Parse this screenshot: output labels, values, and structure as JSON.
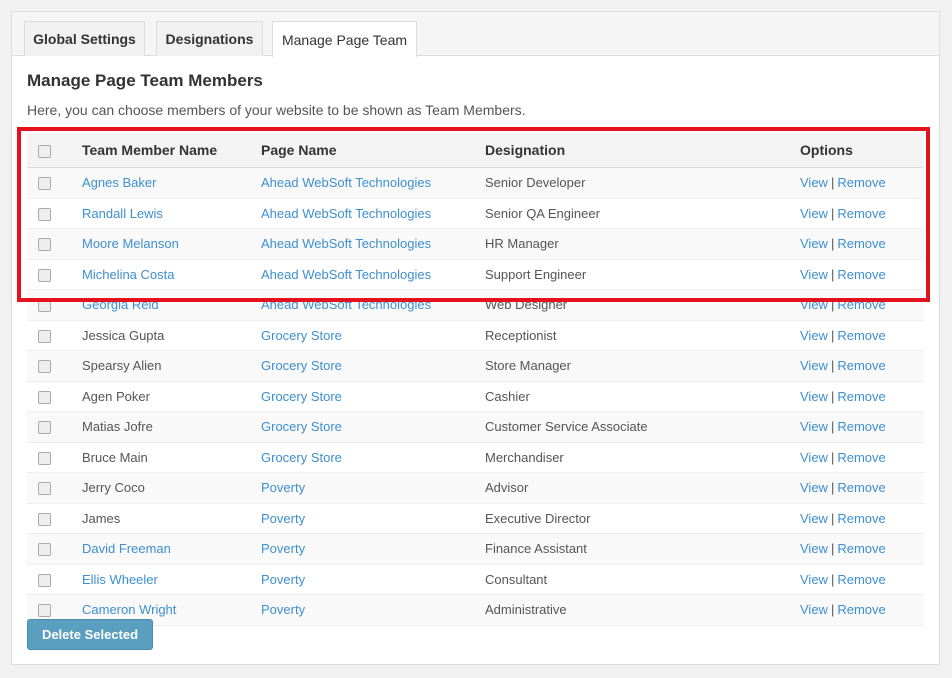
{
  "tabs": [
    {
      "label": "Global Settings"
    },
    {
      "label": "Designations"
    },
    {
      "label": "Manage Page Team"
    }
  ],
  "title": "Manage Page Team Members",
  "description": "Here, you can choose members of your website to be shown as Team Members.",
  "table": {
    "headers": {
      "name": "Team Member Name",
      "page": "Page Name",
      "designation": "Designation",
      "options": "Options"
    },
    "rows": [
      {
        "name": "Agnes Baker",
        "name_link": true,
        "page": "Ahead WebSoft Technologies",
        "designation": "Senior Developer"
      },
      {
        "name": "Randall Lewis",
        "name_link": true,
        "page": "Ahead WebSoft Technologies",
        "designation": "Senior QA Engineer"
      },
      {
        "name": "Moore Melanson",
        "name_link": true,
        "page": "Ahead WebSoft Technologies",
        "designation": "HR Manager"
      },
      {
        "name": "Michelina Costa",
        "name_link": true,
        "page": "Ahead WebSoft Technologies",
        "designation": "Support Engineer"
      },
      {
        "name": "Georgia Reid",
        "name_link": true,
        "page": "Ahead WebSoft Technologies",
        "designation": "Web Designer"
      },
      {
        "name": "Jessica Gupta",
        "name_link": false,
        "page": "Grocery Store",
        "designation": "Receptionist"
      },
      {
        "name": "Spearsy Alien",
        "name_link": false,
        "page": "Grocery Store",
        "designation": "Store Manager"
      },
      {
        "name": "Agen Poker",
        "name_link": false,
        "page": "Grocery Store",
        "designation": "Cashier"
      },
      {
        "name": "Matias Jofre",
        "name_link": false,
        "page": "Grocery Store",
        "designation": "Customer Service Associate"
      },
      {
        "name": "Bruce Main",
        "name_link": false,
        "page": "Grocery Store",
        "designation": "Merchandiser"
      },
      {
        "name": "Jerry Coco",
        "name_link": false,
        "page": "Poverty",
        "designation": "Advisor"
      },
      {
        "name": "James",
        "name_link": false,
        "page": "Poverty",
        "designation": "Executive Director"
      },
      {
        "name": "David Freeman",
        "name_link": true,
        "page": "Poverty",
        "designation": "Finance Assistant"
      },
      {
        "name": "Ellis Wheeler",
        "name_link": true,
        "page": "Poverty",
        "designation": "Consultant"
      },
      {
        "name": "Cameron Wright",
        "name_link": true,
        "page": "Poverty",
        "designation": "Administrative"
      }
    ],
    "option_view": "View",
    "option_sep": "|",
    "option_remove": "Remove"
  },
  "delete_button": "Delete Selected",
  "colors": {
    "link": "#3d8fd1",
    "highlight": "#e5121d",
    "button": "#5a9fc0"
  }
}
